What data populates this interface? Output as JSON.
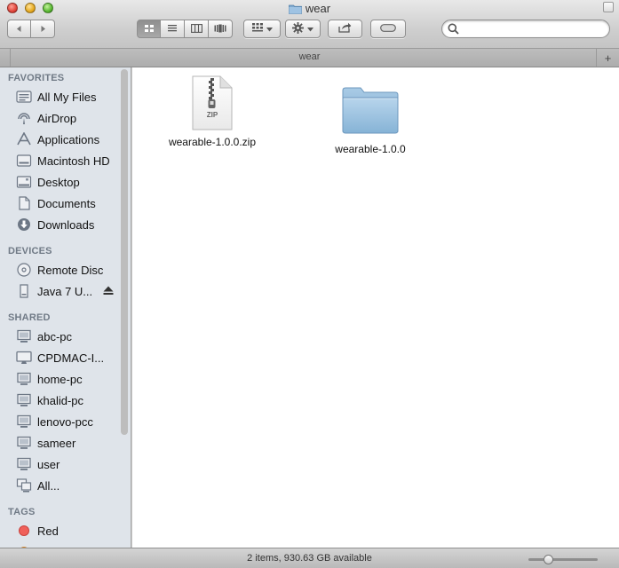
{
  "window": {
    "title": "wear",
    "tab_title": "wear"
  },
  "toolbar": {
    "back_icon": "back-arrow-icon",
    "forward_icon": "forward-arrow-icon",
    "view_modes": [
      "icon-view",
      "list-view",
      "column-view",
      "cover-flow-view"
    ],
    "active_view": "icon-view",
    "arrange_icon": "arrange-icon",
    "action_icon": "gear-icon",
    "share_icon": "share-icon",
    "tags_icon": "tag-icon",
    "search_placeholder": ""
  },
  "sidebar": {
    "sections": [
      {
        "title": "FAVORITES",
        "items": [
          {
            "label": "All My Files",
            "icon": "all-files-icon"
          },
          {
            "label": "AirDrop",
            "icon": "airdrop-icon"
          },
          {
            "label": "Applications",
            "icon": "applications-icon"
          },
          {
            "label": "Macintosh HD",
            "icon": "hard-drive-icon"
          },
          {
            "label": "Desktop",
            "icon": "desktop-icon"
          },
          {
            "label": "Documents",
            "icon": "documents-icon"
          },
          {
            "label": "Downloads",
            "icon": "downloads-icon"
          }
        ]
      },
      {
        "title": "DEVICES",
        "items": [
          {
            "label": "Remote Disc",
            "icon": "remote-disc-icon"
          },
          {
            "label": "Java 7 U...",
            "icon": "disk-image-icon",
            "eject": true
          }
        ]
      },
      {
        "title": "SHARED",
        "items": [
          {
            "label": "abc-pc",
            "icon": "network-pc-icon"
          },
          {
            "label": "CPDMAC-I...",
            "icon": "network-mac-icon"
          },
          {
            "label": "home-pc",
            "icon": "network-pc-icon"
          },
          {
            "label": "khalid-pc",
            "icon": "network-pc-icon"
          },
          {
            "label": "lenovo-pcc",
            "icon": "network-pc-icon"
          },
          {
            "label": "sameer",
            "icon": "network-pc-icon"
          },
          {
            "label": "user",
            "icon": "network-pc-icon"
          },
          {
            "label": "All...",
            "icon": "network-icon"
          }
        ]
      },
      {
        "title": "TAGS",
        "items": [
          {
            "label": "Red",
            "icon": "red-tag-icon",
            "color": "#f0605a"
          }
        ]
      }
    ]
  },
  "files": [
    {
      "name": "wearable-1.0.0.zip",
      "type": "zip",
      "badge": "ZIP"
    },
    {
      "name": "wearable-1.0.0",
      "type": "folder"
    }
  ],
  "status": {
    "text": "2 items, 930.63 GB available",
    "icon_size": 0.25
  },
  "colors": {
    "sidebar_bg": "#dfe4ea",
    "section_title": "#707a86",
    "folder_blue": "#86b3d6"
  }
}
